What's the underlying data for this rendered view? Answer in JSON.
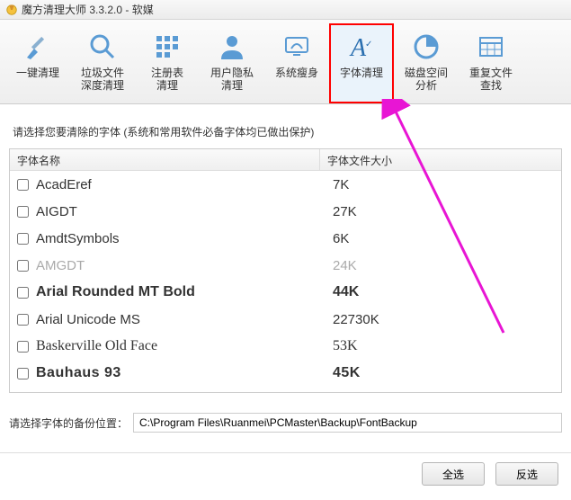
{
  "titlebar": {
    "text": "魔方清理大师 3.3.2.0 - 软媒"
  },
  "toolbar": {
    "items": [
      {
        "label": "一键清理"
      },
      {
        "label": "垃圾文件\n深度清理"
      },
      {
        "label": "注册表\n清理"
      },
      {
        "label": "用户隐私\n清理"
      },
      {
        "label": "系统瘦身"
      },
      {
        "label": "字体清理"
      },
      {
        "label": "磁盘空间\n分析"
      },
      {
        "label": "重复文件\n查找"
      }
    ]
  },
  "instruction": "请选择您要清除的字体 (系统和常用软件必备字体均已做出保护)",
  "table": {
    "col_name": "字体名称",
    "col_size": "字体文件大小",
    "rows": [
      {
        "name": "AcadEref",
        "size": "7K",
        "cls": ""
      },
      {
        "name": "AIGDT",
        "size": "27K",
        "cls": ""
      },
      {
        "name": "AmdtSymbols",
        "size": "6K",
        "cls": ""
      },
      {
        "name": "AMGDT",
        "size": "24K",
        "cls": "disabled"
      },
      {
        "name": "Arial Rounded MT Bold",
        "size": "44K",
        "cls": "bold"
      },
      {
        "name": "Arial Unicode MS",
        "size": "22730K",
        "cls": ""
      },
      {
        "name": "Baskerville Old Face",
        "size": "53K",
        "cls": "serif"
      },
      {
        "name": "Bauhaus 93",
        "size": "45K",
        "cls": "bauhaus"
      }
    ]
  },
  "backup": {
    "label": "请选择字体的备份位置：",
    "path": "C:\\Program Files\\Ruanmei\\PCMaster\\Backup\\FontBackup"
  },
  "footer": {
    "select_all": "全选",
    "invert": "反选"
  }
}
